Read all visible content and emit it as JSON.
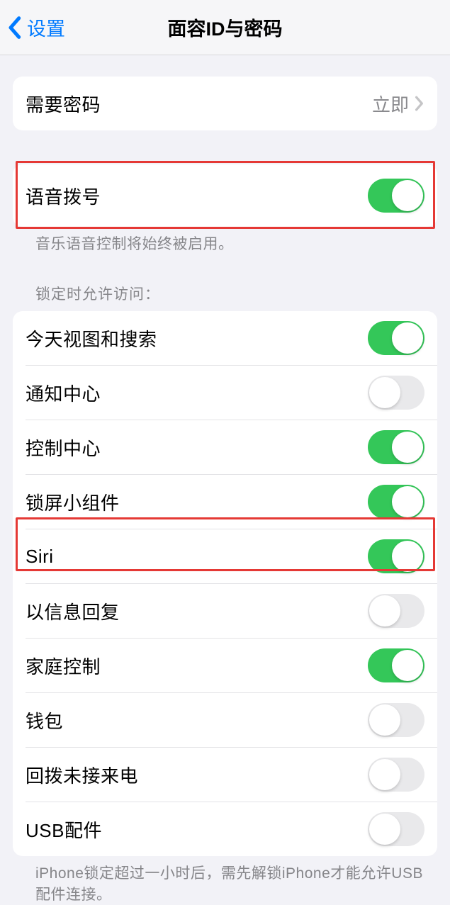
{
  "header": {
    "back_label": "设置",
    "title": "面容ID与密码"
  },
  "require_passcode": {
    "label": "需要密码",
    "value": "立即"
  },
  "voice_dial": {
    "label": "语音拨号",
    "on": true,
    "footer": "音乐语音控制将始终被启用。"
  },
  "locked_section": {
    "header": "锁定时允许访问：",
    "items": [
      {
        "label": "今天视图和搜索",
        "on": true
      },
      {
        "label": "通知中心",
        "on": false
      },
      {
        "label": "控制中心",
        "on": true
      },
      {
        "label": "锁屏小组件",
        "on": true
      },
      {
        "label": "Siri",
        "on": true
      },
      {
        "label": "以信息回复",
        "on": false
      },
      {
        "label": "家庭控制",
        "on": true
      },
      {
        "label": "钱包",
        "on": false
      },
      {
        "label": "回拨未接来电",
        "on": false
      },
      {
        "label": "USB配件",
        "on": false
      }
    ],
    "footer": "iPhone锁定超过一小时后，需先解锁iPhone才能允许USB配件连接。"
  }
}
